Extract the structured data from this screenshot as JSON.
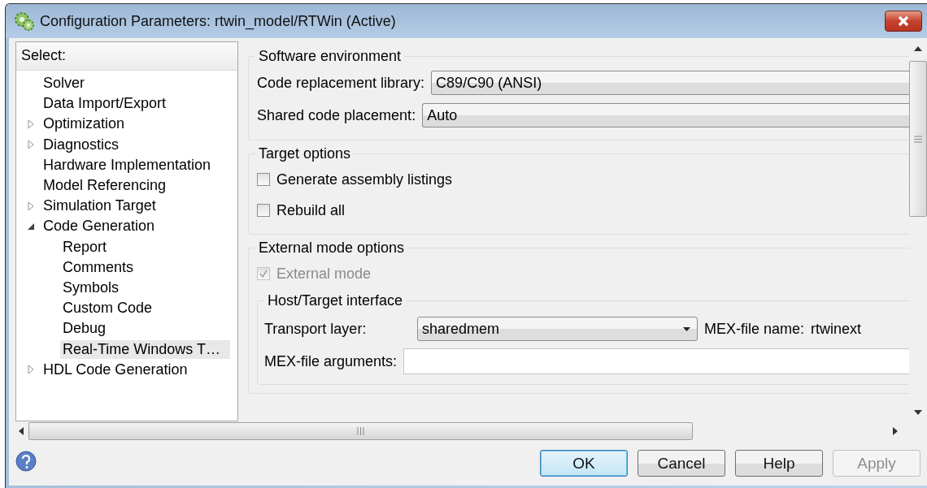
{
  "window": {
    "title": "Configuration Parameters: rtwin_model/RTWin (Active)"
  },
  "tree": {
    "header": "Select:",
    "items": [
      {
        "label": "Solver",
        "kind": "leaf",
        "selected": false
      },
      {
        "label": "Data Import/Export",
        "kind": "leaf",
        "selected": false
      },
      {
        "label": "Optimization",
        "kind": "node",
        "expanded": false,
        "selected": false
      },
      {
        "label": "Diagnostics",
        "kind": "node",
        "expanded": false,
        "selected": false
      },
      {
        "label": "Hardware Implementation",
        "kind": "leaf",
        "selected": false
      },
      {
        "label": "Model Referencing",
        "kind": "leaf",
        "selected": false
      },
      {
        "label": "Simulation Target",
        "kind": "node",
        "expanded": false,
        "selected": false
      },
      {
        "label": "Code Generation",
        "kind": "node",
        "expanded": true,
        "selected": false,
        "children": [
          {
            "label": "Report",
            "kind": "leaf",
            "selected": false
          },
          {
            "label": "Comments",
            "kind": "leaf",
            "selected": false
          },
          {
            "label": "Symbols",
            "kind": "leaf",
            "selected": false
          },
          {
            "label": "Custom Code",
            "kind": "leaf",
            "selected": false
          },
          {
            "label": "Debug",
            "kind": "leaf",
            "selected": false
          },
          {
            "label": "Real-Time Windows T…",
            "kind": "leaf",
            "selected": true
          }
        ]
      },
      {
        "label": "HDL Code Generation",
        "kind": "node",
        "expanded": false,
        "selected": false
      }
    ]
  },
  "groups": [
    {
      "title": "Software environment",
      "rows": [
        {
          "kind": "dropdown",
          "label": "Code replacement library:",
          "value": "C89/C90 (ANSI)"
        },
        {
          "kind": "dropdown",
          "label": "Shared code placement:",
          "value": "Auto"
        }
      ]
    },
    {
      "title": "Target options",
      "rows": [
        {
          "kind": "checkbox",
          "label": "Generate assembly listings",
          "checked": false,
          "disabled": false
        },
        {
          "kind": "checkbox",
          "label": "Rebuild all",
          "checked": false,
          "disabled": false
        }
      ]
    },
    {
      "title": "External mode options",
      "rows": [
        {
          "kind": "checkbox",
          "label": "External mode",
          "checked": true,
          "disabled": true
        },
        {
          "kind": "subgroup",
          "title": "Host/Target interface",
          "rows": [
            {
              "kind": "transport",
              "label": "Transport layer:",
              "value": "sharedmem",
              "name_label": "MEX-file name:",
              "name_value": "rtwinext"
            },
            {
              "kind": "input",
              "label": "MEX-file arguments:"
            }
          ]
        }
      ]
    }
  ],
  "buttons": [
    {
      "label": "OK",
      "default": true,
      "disabled": false
    },
    {
      "label": "Cancel",
      "default": false,
      "disabled": false
    },
    {
      "label": "Help",
      "default": false,
      "disabled": false
    },
    {
      "label": "Apply",
      "default": false,
      "disabled": true
    }
  ]
}
